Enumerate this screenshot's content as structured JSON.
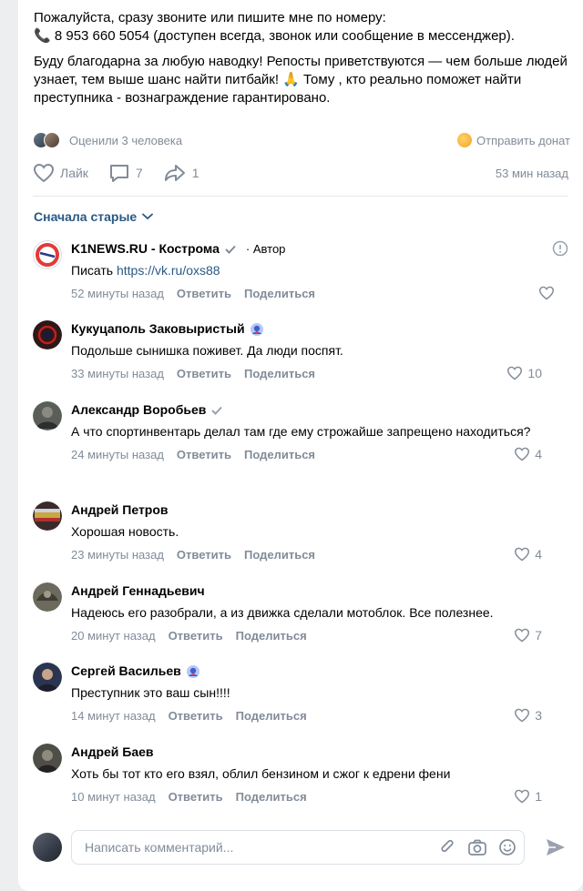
{
  "post": {
    "para1_line1": "Пожалуйста, сразу звоните или пишите мне по номеру:",
    "para1_phone": "📞",
    "para1_line2": " 8 953 660 5054 (доступен всегда, звонок или сообщение в мессенджер).",
    "para2": "Буду благодарна за любую наводку! Репосты приветствуются — чем больше людей узнает, тем выше шанс найти питбайк! 🙏 Тому , кто реально поможет найти преступника - вознаграждение гарантировано."
  },
  "meta": {
    "rated": "Оценили 3 человека",
    "donate": "Отправить донат"
  },
  "actions": {
    "like": "Лайк",
    "comments": "7",
    "shares": "1",
    "time": "53 мин назад"
  },
  "sort": {
    "label": "Сначала старые"
  },
  "labels": {
    "reply": "Ответить",
    "share": "Поделиться",
    "author": "Автор"
  },
  "comments": [
    {
      "name": "K1NEWS.RU - Кострома",
      "text_prefix": "Писать ",
      "link": "https://vk.ru/oxs88",
      "time": "52 минуты назад",
      "likes": ""
    },
    {
      "name": "Кукуцаполь Заковыристый",
      "text": "Подольше сынишка поживет. Да люди поспят.",
      "time": "33 минуты назад",
      "likes": "10"
    },
    {
      "name": "Александр Воробьев",
      "text": "А что спортинвентарь делал там где ему строжайше запрещено находиться?",
      "time": "24 минуты назад",
      "likes": "4"
    },
    {
      "name": "Андрей Петров",
      "text": "Хорошая новость.",
      "time": "23 минуты назад",
      "likes": "4"
    },
    {
      "name": "Андрей Геннадьевич",
      "text": "Надеюсь его разобрали, а из движка сделали мотоблок. Все полезнее.",
      "time": "20 минут назад",
      "likes": "7"
    },
    {
      "name": "Сергей Васильев",
      "text": "Преступник это ваш сын!!!!",
      "time": "14 минут назад",
      "likes": "3"
    },
    {
      "name": "Андрей Баев",
      "text": "Хоть бы тот кто его взял, облил бензином и сжог к едрени фени",
      "time": "10 минут назад",
      "likes": "1"
    }
  ],
  "composer": {
    "placeholder": "Написать комментарий..."
  },
  "colors": {
    "link": "#2a5885",
    "secondary": "#818c99",
    "send": "#99a2ad"
  }
}
